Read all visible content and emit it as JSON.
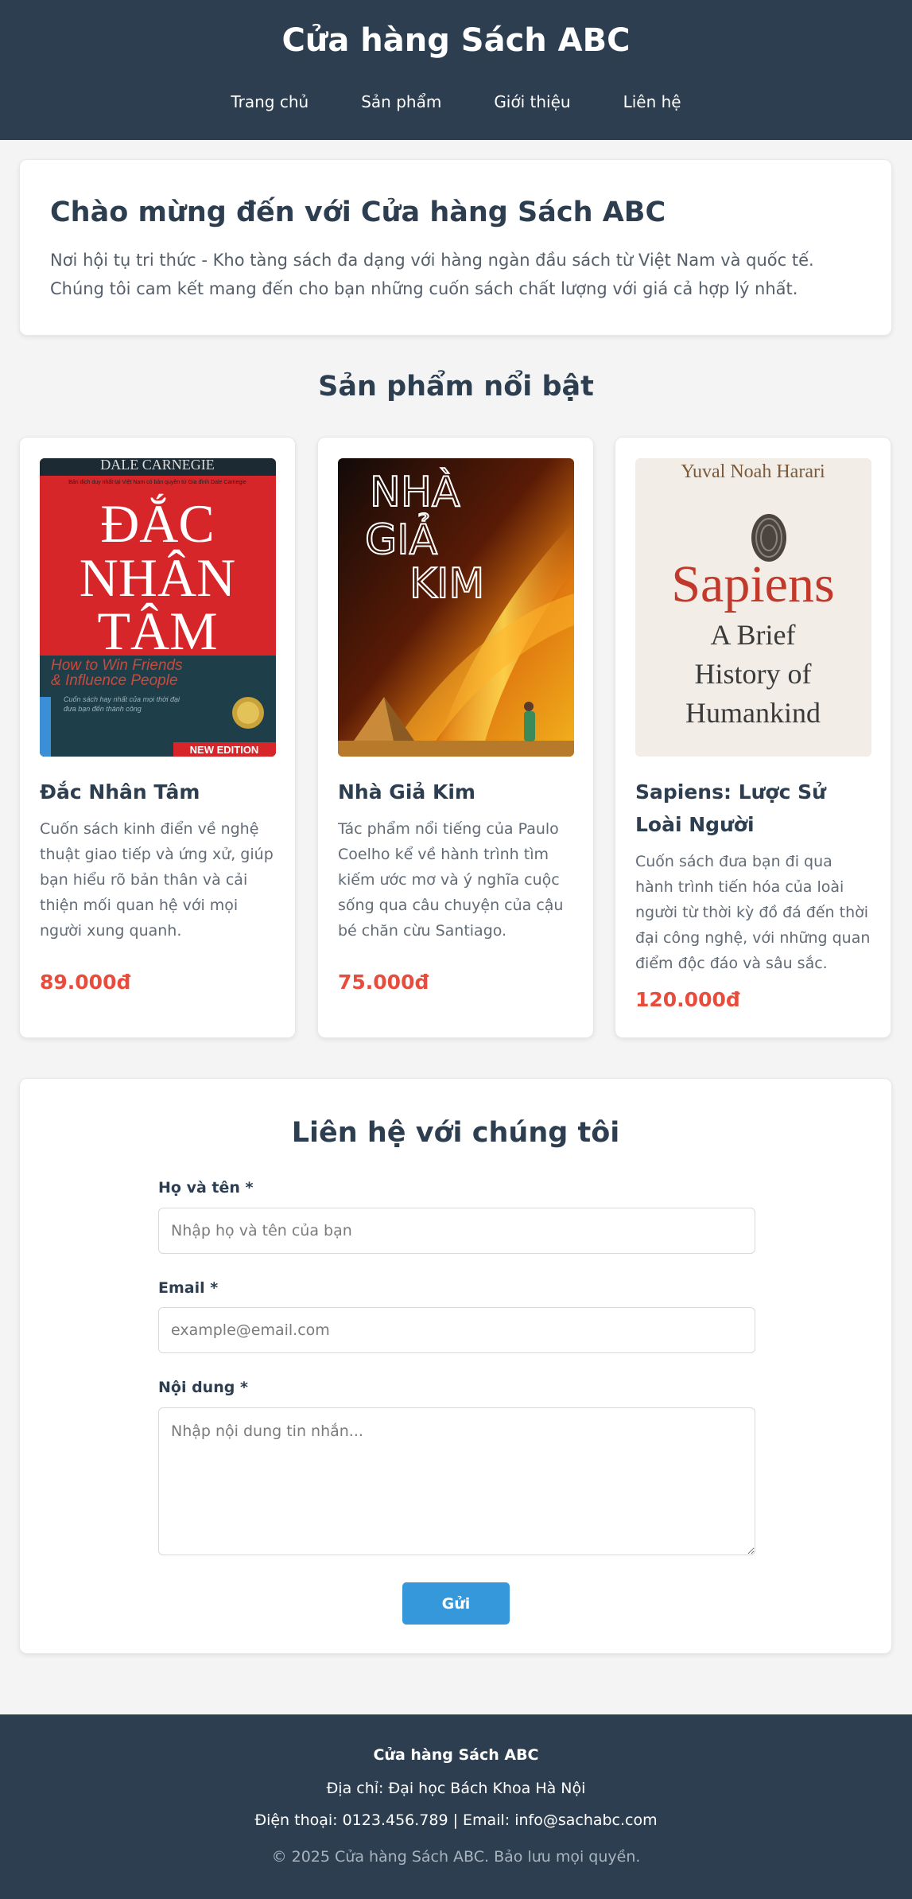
{
  "header": {
    "title": "Cửa hàng Sách ABC",
    "nav": [
      "Trang chủ",
      "Sản phẩm",
      "Giới thiệu",
      "Liên hệ"
    ]
  },
  "welcome": {
    "title": "Chào mừng đến với Cửa hàng Sách ABC",
    "text": "Nơi hội tụ tri thức - Kho tàng sách đa dạng với hàng ngàn đầu sách từ Việt Nam và quốc tế. Chúng tôi cam kết mang đến cho bạn những cuốn sách chất lượng với giá cả hợp lý nhất."
  },
  "products": {
    "section_title": "Sản phẩm nổi bật",
    "items": [
      {
        "name": "Đắc Nhân Tâm",
        "desc": "Cuốn sách kinh điển về nghệ thuật giao tiếp và ứng xử, giúp bạn hiểu rõ bản thân và cải thiện mối quan hệ với mọi người xung quanh.",
        "price": "89.000đ",
        "cover": {
          "author": "DALE CARNEGIE",
          "small_line": "Bản dịch duy nhất tại Việt Nam có bản quyền từ Gia đình Dale Carnegie",
          "title_lines": [
            "ĐẮC",
            "NHÂN",
            "TÂM"
          ],
          "subtitle_lines": [
            "How to Win Friends",
            "& Influence People"
          ],
          "tagline_lines": [
            "Cuốn sách hay nhất của mọi thời đại",
            "đưa bạn đến thành công"
          ],
          "badge": "NEW EDITION"
        }
      },
      {
        "name": "Nhà Giả Kim",
        "desc": "Tác phẩm nổi tiếng của Paulo Coelho kể về hành trình tìm kiếm ước mơ và ý nghĩa cuộc sống qua câu chuyện của cậu bé chăn cừu Santiago.",
        "price": "75.000đ",
        "cover": {
          "title_lines": [
            "NHÀ",
            "GIẢ",
            "KIM"
          ]
        }
      },
      {
        "name": "Sapiens: Lược Sử Loài Người",
        "desc": "Cuốn sách đưa bạn đi qua hành trình tiến hóa của loài người từ thời kỳ đồ đá đến thời đại công nghệ, với những quan điểm độc đáo và sâu sắc.",
        "price": "120.000đ",
        "cover": {
          "author": "Yuval Noah Harari",
          "title": "Sapiens",
          "subtitle_lines": [
            "A Brief",
            "History of",
            "Humankind"
          ]
        }
      }
    ]
  },
  "contact": {
    "title": "Liên hệ với chúng tôi",
    "name_label": "Họ và tên *",
    "name_placeholder": "Nhập họ và tên của bạn",
    "email_label": "Email *",
    "email_placeholder": "example@email.com",
    "message_label": "Nội dung *",
    "message_placeholder": "Nhập nội dung tin nhắn...",
    "submit_label": "Gửi"
  },
  "footer": {
    "name": "Cửa hàng Sách ABC",
    "address": "Địa chỉ: Đại học Bách Khoa Hà Nội",
    "contact": "Điện thoại: 0123.456.789 | Email: info@sachabc.com",
    "copyright": "© 2025 Cửa hàng Sách ABC. Bảo lưu mọi quyền."
  },
  "colors": {
    "header_bg": "#2c3e50",
    "price": "#e74c3c",
    "button": "#3498db",
    "page_bg": "#f4f4f4"
  }
}
